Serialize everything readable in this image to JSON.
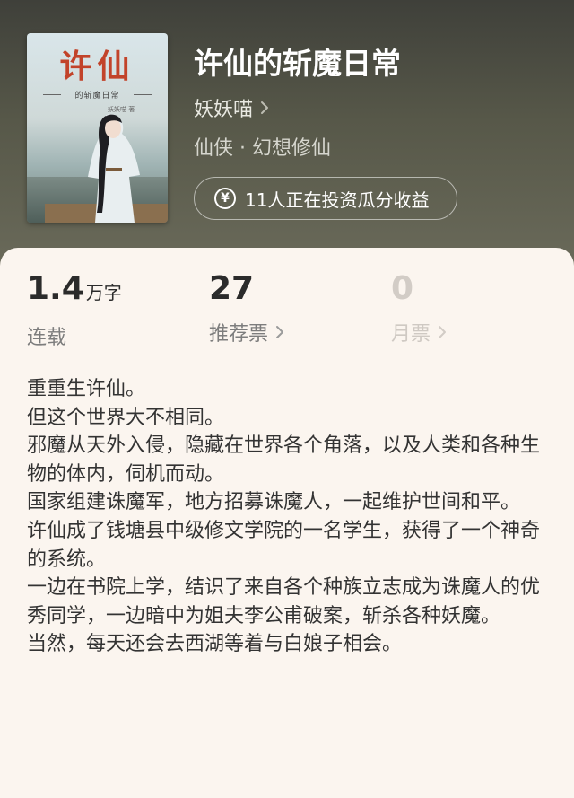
{
  "book": {
    "cover_title": "许仙",
    "cover_subtitle": "的斩魔日常",
    "cover_author": "妖妖喵 著",
    "title": "许仙的斩魔日常",
    "author": "妖妖喵",
    "genre": "仙侠 · 幻想修仙",
    "invest_label": "11人正在投资瓜分收益"
  },
  "stats": {
    "words_value": "1.4",
    "words_unit": "万字",
    "status": "连载",
    "recommend_value": "27",
    "recommend_label": "推荐票",
    "monthly_value": "0",
    "monthly_label": "月票"
  },
  "description": [
    "重重生许仙。",
    "但这个世界大不相同。",
    "邪魔从天外入侵，隐藏在世界各个角落，以及人类和各种生物的体内，伺机而动。",
    "国家组建诛魔军，地方招募诛魔人，一起维护世间和平。",
    "许仙成了钱塘县中级修文学院的一名学生，获得了一个神奇的系统。",
    "一边在书院上学，结识了来自各个种族立志成为诛魔人的优秀同学，一边暗中为姐夫李公甫破案，斩杀各种妖魔。",
    "当然，每天还会去西湖等着与白娘子相会。"
  ],
  "icons": {
    "yen": "yen-circle-icon",
    "chevron": "chevron-right-icon"
  },
  "colors": {
    "hero_bg": "#575849",
    "panel_bg": "#fbf5ef",
    "cover_title_red": "#c2432a"
  }
}
